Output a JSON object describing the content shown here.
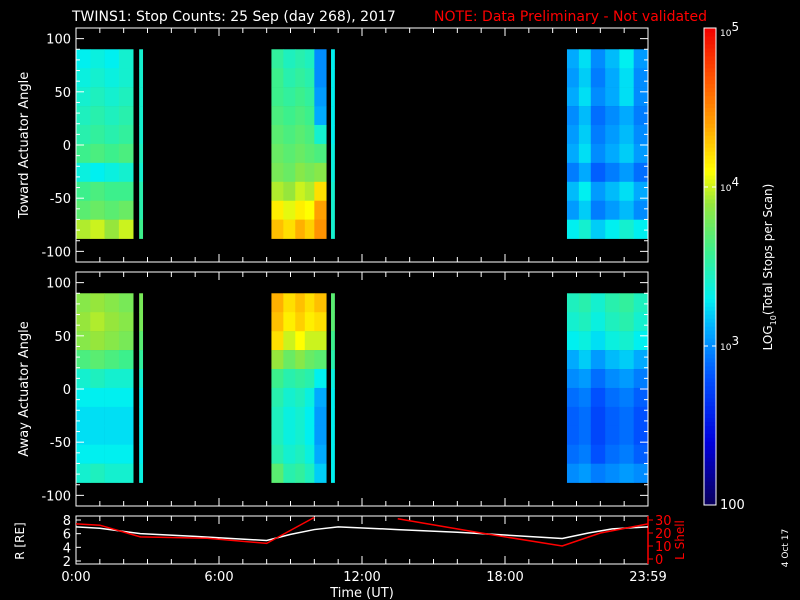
{
  "title": "TWINS1: Stop Counts: 25 Sep (day 268), 2017",
  "note": "NOTE: Data Preliminary - Not validated",
  "date_stamp": "4 Oct 17",
  "colors": {
    "note": "#ff0000",
    "lshell": "#ff0000",
    "radius": "#ffffff"
  },
  "chart_data": [
    {
      "type": "heatmap",
      "name": "toward",
      "ylabel": "Toward Actuator Angle",
      "ylim": [
        -110,
        110
      ],
      "yticks": [
        "100",
        "50",
        "0",
        "-50",
        "-100"
      ],
      "ytick_values": [
        100,
        50,
        0,
        -50,
        -100
      ],
      "xlim_hours": [
        0,
        24
      ],
      "row_angle_edges": [
        90,
        72.2,
        54.4,
        36.6,
        18.8,
        1,
        -16.8,
        -34.6,
        -52.4,
        -70.2,
        -88
      ],
      "value_scale": "log10 counts",
      "columns": [
        {
          "t": [
            0.0,
            0.6
          ],
          "v": [
            3.3,
            3.35,
            3.4,
            3.45,
            3.5,
            3.6,
            3.35,
            3.6,
            3.7,
            3.95
          ]
        },
        {
          "t": [
            0.6,
            1.2
          ],
          "v": [
            3.35,
            3.4,
            3.45,
            3.5,
            3.55,
            3.65,
            3.3,
            3.65,
            3.75,
            4.0
          ]
        },
        {
          "t": [
            1.2,
            1.8
          ],
          "v": [
            3.3,
            3.35,
            3.4,
            3.45,
            3.5,
            3.6,
            3.35,
            3.6,
            3.7,
            3.9
          ]
        },
        {
          "t": [
            1.8,
            2.4
          ],
          "v": [
            3.4,
            3.4,
            3.45,
            3.5,
            3.55,
            3.65,
            3.4,
            3.6,
            3.75,
            4.0
          ]
        },
        {
          "t": [
            2.65,
            2.8
          ],
          "v": [
            3.4,
            3.4,
            3.4,
            3.4,
            3.4,
            3.45,
            3.4,
            3.5,
            3.5,
            3.6
          ]
        },
        {
          "t": [
            8.2,
            8.7
          ],
          "v": [
            3.55,
            3.6,
            3.6,
            3.65,
            3.7,
            3.75,
            3.8,
            3.95,
            4.15,
            4.3
          ]
        },
        {
          "t": [
            8.7,
            9.2
          ],
          "v": [
            3.45,
            3.5,
            3.55,
            3.6,
            3.65,
            3.7,
            3.75,
            3.9,
            4.05,
            4.2
          ]
        },
        {
          "t": [
            9.2,
            9.6
          ],
          "v": [
            3.5,
            3.55,
            3.6,
            3.65,
            3.7,
            3.75,
            3.85,
            4.0,
            4.15,
            4.35
          ]
        },
        {
          "t": [
            9.6,
            10.0
          ],
          "v": [
            3.45,
            3.5,
            3.55,
            3.6,
            3.65,
            3.7,
            3.8,
            3.95,
            4.1,
            4.25
          ]
        },
        {
          "t": [
            10.0,
            10.5
          ],
          "v": [
            3.0,
            3.0,
            3.05,
            3.1,
            3.4,
            3.65,
            3.85,
            4.2,
            4.4,
            4.45
          ]
        },
        {
          "t": [
            10.7,
            10.85
          ],
          "v": [
            3.3,
            3.3,
            3.3,
            3.3,
            3.3,
            3.35,
            3.35,
            3.4,
            3.4,
            3.4
          ]
        },
        {
          "t": [
            20.6,
            21.1
          ],
          "v": [
            3.1,
            3.05,
            3.1,
            3.0,
            3.05,
            3.1,
            2.95,
            3.15,
            3.05,
            3.3
          ]
        },
        {
          "t": [
            21.1,
            21.6
          ],
          "v": [
            3.25,
            3.2,
            3.25,
            3.15,
            3.2,
            3.25,
            3.1,
            3.3,
            3.2,
            3.4
          ]
        },
        {
          "t": [
            21.6,
            22.2
          ],
          "v": [
            3.0,
            2.95,
            3.0,
            2.9,
            2.95,
            3.0,
            2.85,
            3.05,
            2.95,
            3.2
          ]
        },
        {
          "t": [
            22.2,
            22.8
          ],
          "v": [
            3.15,
            3.1,
            3.1,
            3.0,
            3.05,
            3.1,
            2.95,
            3.15,
            3.05,
            3.3
          ]
        },
        {
          "t": [
            22.8,
            23.4
          ],
          "v": [
            3.3,
            3.25,
            3.25,
            3.1,
            3.15,
            3.2,
            3.05,
            3.25,
            3.15,
            3.4
          ]
        },
        {
          "t": [
            23.4,
            24.0
          ],
          "v": [
            3.05,
            3.0,
            3.0,
            2.95,
            3.0,
            3.05,
            2.9,
            3.1,
            3.0,
            3.3
          ]
        }
      ]
    },
    {
      "type": "heatmap",
      "name": "away",
      "ylabel": "Away Actuator Angle",
      "ylim": [
        -110,
        110
      ],
      "yticks": [
        "100",
        "50",
        "0",
        "-50",
        "-100"
      ],
      "ytick_values": [
        100,
        50,
        0,
        -50,
        -100
      ],
      "xlim_hours": [
        0,
        24
      ],
      "row_angle_edges": [
        90,
        72.2,
        54.4,
        36.6,
        18.8,
        1,
        -16.8,
        -34.6,
        -52.4,
        -70.2,
        -88
      ],
      "value_scale": "log10 counts",
      "columns": [
        {
          "t": [
            0.0,
            0.6
          ],
          "v": [
            3.85,
            3.9,
            3.85,
            3.65,
            3.4,
            3.3,
            3.25,
            3.25,
            3.3,
            3.4
          ]
        },
        {
          "t": [
            0.6,
            1.2
          ],
          "v": [
            3.9,
            3.95,
            3.9,
            3.7,
            3.45,
            3.3,
            3.25,
            3.25,
            3.3,
            3.45
          ]
        },
        {
          "t": [
            1.2,
            1.8
          ],
          "v": [
            3.85,
            3.9,
            3.85,
            3.65,
            3.4,
            3.3,
            3.25,
            3.25,
            3.3,
            3.4
          ]
        },
        {
          "t": [
            1.8,
            2.4
          ],
          "v": [
            3.8,
            3.85,
            3.8,
            3.6,
            3.4,
            3.3,
            3.25,
            3.25,
            3.3,
            3.4
          ]
        },
        {
          "t": [
            2.65,
            2.8
          ],
          "v": [
            3.8,
            3.8,
            3.7,
            3.55,
            3.4,
            3.3,
            3.3,
            3.3,
            3.3,
            3.35
          ]
        },
        {
          "t": [
            8.2,
            8.7
          ],
          "v": [
            4.35,
            4.3,
            4.2,
            3.9,
            3.6,
            3.5,
            3.45,
            3.45,
            3.5,
            3.7
          ]
        },
        {
          "t": [
            8.7,
            9.2
          ],
          "v": [
            4.2,
            4.15,
            4.0,
            3.75,
            3.5,
            3.4,
            3.35,
            3.35,
            3.4,
            3.5
          ]
        },
        {
          "t": [
            9.2,
            9.6
          ],
          "v": [
            4.3,
            4.25,
            4.1,
            3.85,
            3.55,
            3.45,
            3.4,
            3.4,
            3.45,
            3.55
          ]
        },
        {
          "t": [
            9.6,
            10.0
          ],
          "v": [
            4.2,
            4.15,
            4.0,
            3.75,
            3.5,
            3.35,
            3.3,
            3.3,
            3.35,
            3.45
          ]
        },
        {
          "t": [
            10.0,
            10.5
          ],
          "v": [
            4.3,
            4.2,
            4.0,
            3.7,
            3.3,
            3.1,
            3.05,
            3.05,
            3.1,
            3.2
          ]
        },
        {
          "t": [
            10.7,
            10.85
          ],
          "v": [
            3.7,
            3.7,
            3.6,
            3.5,
            3.35,
            3.3,
            3.3,
            3.3,
            3.3,
            3.3
          ]
        },
        {
          "t": [
            20.6,
            21.1
          ],
          "v": [
            3.45,
            3.4,
            3.3,
            3.1,
            3.0,
            2.9,
            2.85,
            2.85,
            2.9,
            3.0
          ]
        },
        {
          "t": [
            21.1,
            21.6
          ],
          "v": [
            3.5,
            3.45,
            3.35,
            3.2,
            3.05,
            2.95,
            2.9,
            2.9,
            2.95,
            3.05
          ]
        },
        {
          "t": [
            21.6,
            22.2
          ],
          "v": [
            3.4,
            3.35,
            3.25,
            3.05,
            2.9,
            2.8,
            2.75,
            2.75,
            2.8,
            2.95
          ]
        },
        {
          "t": [
            22.2,
            22.8
          ],
          "v": [
            3.5,
            3.45,
            3.35,
            3.15,
            3.0,
            2.9,
            2.85,
            2.85,
            2.9,
            3.0
          ]
        },
        {
          "t": [
            22.8,
            23.4
          ],
          "v": [
            3.55,
            3.5,
            3.4,
            3.2,
            3.05,
            2.95,
            2.9,
            2.9,
            2.95,
            3.05
          ]
        },
        {
          "t": [
            23.4,
            24.0
          ],
          "v": [
            3.45,
            3.4,
            3.3,
            3.1,
            2.95,
            2.85,
            2.8,
            2.8,
            2.85,
            3.0
          ]
        }
      ]
    },
    {
      "type": "line",
      "name": "orbit",
      "xlabel": "Time (UT)",
      "xticks": [
        "0:00",
        "6:00",
        "12:00",
        "18:00",
        "23:59"
      ],
      "xtick_hours": [
        0,
        6,
        12,
        18,
        24
      ],
      "left_ylabel": "R [RE]",
      "left_yticks": [
        "8",
        "6",
        "4",
        "2"
      ],
      "left_ytick_values": [
        8,
        6,
        4,
        2
      ],
      "right_ylabel": "L Shell",
      "right_yticks": [
        "30",
        "20",
        "10",
        "0"
      ],
      "right_ytick_values": [
        30,
        20,
        10,
        0
      ],
      "series": [
        {
          "name": "R",
          "axis": "left",
          "x": [
            0,
            1,
            2.7,
            5,
            8,
            9,
            10,
            11,
            13.5,
            16,
            18,
            20.4,
            21.5,
            22.5,
            24
          ],
          "y": [
            7,
            6.8,
            6,
            5.6,
            5.0,
            5.9,
            6.6,
            7.0,
            6.6,
            6.2,
            5.8,
            5.3,
            6.1,
            6.7,
            7.0
          ]
        },
        {
          "name": "L Shell",
          "axis": "right",
          "segments": [
            {
              "x": [
                0,
                1,
                2.7,
                5.5,
                8,
                10
              ],
              "y": [
                27,
                26,
                17,
                16,
                12,
                32
              ]
            },
            {
              "x": [
                13.5,
                17,
                20.4,
                22,
                24
              ],
              "y": [
                31,
                20,
                10,
                20,
                27
              ]
            }
          ]
        }
      ]
    }
  ],
  "colorbar": {
    "label": "LOG10(Total Stops per Scan)",
    "label_main": "LOG",
    "label_sub": "10",
    "label_rest": "(Total Stops per Scan)",
    "range_log10": [
      2,
      5
    ],
    "ticks": [
      {
        "base": "10",
        "exp": "5",
        "value": 5
      },
      {
        "base": "10",
        "exp": "4",
        "value": 4
      },
      {
        "base": "10",
        "exp": "3",
        "value": 3
      },
      {
        "base": "100",
        "exp": "",
        "value": 2
      }
    ]
  }
}
